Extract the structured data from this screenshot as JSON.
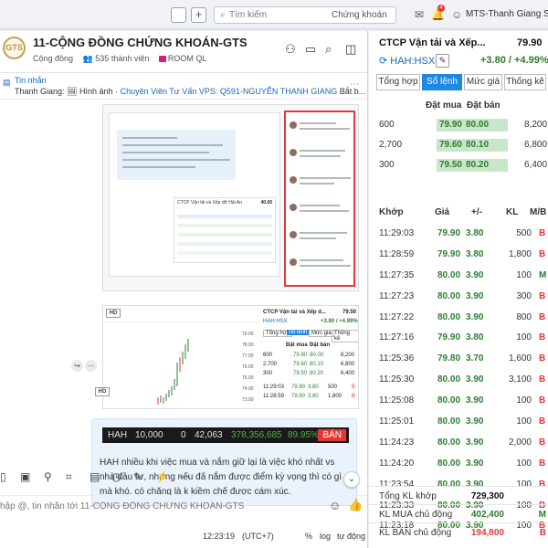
{
  "topbar": {
    "add": "+",
    "search_placeholder": "Tìm kiếm",
    "search_scope": "Chứng khoán",
    "notif_count": "4",
    "username": "MTS-Thanh Giang Stock"
  },
  "chat": {
    "group_name": "11-CỘNG ĐỒNG CHỨNG KHOÁN-GTS",
    "group_type": "Cộng đồng",
    "member_count": "535 thành viên",
    "room_tag": "ROOM QL",
    "pinned": {
      "title": "Tin nhắn",
      "sender": "Thanh Giang:",
      "kind": "Hình ảnh",
      "link_text": "Chuyên Viên Tư Vấn VPS: Q591-NGUYỄN THANH GIANG",
      "suffix": "Bắt b..."
    },
    "hd_label": "HD",
    "shot1": {
      "card_title": "CTCP Vận tải và Xếp dỡ Hải An",
      "card_price": "40.00"
    },
    "shot2": {
      "title": "CTCP Vận tải và Xếp d...",
      "price": "79.50",
      "symbol": "HAH:HSX",
      "change": "+3.80 / +4.99%",
      "tabs": [
        "Tổng hợp",
        "Sổ lệnh",
        "Mức giá",
        "Thống kê"
      ],
      "col_buy": "Đặt mua",
      "col_sell": "Đặt bán",
      "book": [
        {
          "vol": "600",
          "bid": "79.90",
          "ask": "80.00",
          "avol": "8,200"
        },
        {
          "vol": "2,700",
          "bid": "79.60",
          "ask": "80.10",
          "avol": "6,800"
        },
        {
          "vol": "300",
          "bid": "79.50",
          "ask": "80.20",
          "avol": "6,400"
        }
      ],
      "trades": [
        {
          "time": "11:29:03",
          "price": "79.90",
          "chg": "3.80",
          "vol": "500",
          "side": "B"
        },
        {
          "time": "11:28:59",
          "price": "79.90",
          "chg": "3.80",
          "vol": "1,800",
          "side": "B"
        }
      ],
      "axis": [
        "79.00",
        "78.00",
        "77.00",
        "76.00",
        "75.00",
        "74.00",
        "73.00"
      ]
    },
    "shot3": {
      "symbol": "HAH",
      "vol": "10,000",
      "zero": "0",
      "total": "42,063",
      "value": "378,356,685",
      "pct": "89.95%",
      "action": "BÁN"
    },
    "message_text": "HAH nhiều khi việc mua và nắm giữ lại là việc khó nhất vs nhà đầu tư, nhưng nếu đã nắm được điểm kỳ vọng thì có gì mà khó. có chăng là k kiềm chế được cám xúc.",
    "compose_placeholder": "hập @, tin nhắn tới 11-CỘNG ĐỒNG CHỨNG KHOÁN-GTS",
    "status": {
      "time": "12:23:19",
      "tz": "(UTC+7)",
      "percent": "%",
      "log": "log",
      "mode": "tự động"
    }
  },
  "panel": {
    "title": "CTCP Vận tải và Xếp...",
    "price": "79.90",
    "symbol": "HAH:HSX",
    "change": "+3.80 / +4.99%",
    "tabs": [
      "Tổng hợp",
      "Sổ lệnh",
      "Mức giá",
      "Thống kê"
    ],
    "active_tab": 1,
    "col_buy": "Đặt mua",
    "col_sell": "Đặt bán",
    "book": [
      {
        "vol": "600",
        "bid": "79.90",
        "ask": "80.00",
        "avol": "8,200"
      },
      {
        "vol": "2,700",
        "bid": "79.60",
        "ask": "80.10",
        "avol": "6,800"
      },
      {
        "vol": "300",
        "bid": "79.50",
        "ask": "80.20",
        "avol": "6,400"
      }
    ],
    "trade_headers": [
      "Khớp",
      "Giá",
      "+/-",
      "KL",
      "M/B"
    ],
    "trades": [
      {
        "time": "11:29:03",
        "price": "79.90",
        "chg": "3.80",
        "vol": "500",
        "side": "B"
      },
      {
        "time": "11:28:59",
        "price": "79.90",
        "chg": "3.80",
        "vol": "1,800",
        "side": "B"
      },
      {
        "time": "11:27:35",
        "price": "80.00",
        "chg": "3.90",
        "vol": "100",
        "side": "M"
      },
      {
        "time": "11:27:23",
        "price": "80.00",
        "chg": "3.90",
        "vol": "300",
        "side": "B"
      },
      {
        "time": "11:27:22",
        "price": "80.00",
        "chg": "3.90",
        "vol": "800",
        "side": "B"
      },
      {
        "time": "11:27:16",
        "price": "79.90",
        "chg": "3.80",
        "vol": "100",
        "side": "B"
      },
      {
        "time": "11:25:36",
        "price": "79.80",
        "chg": "3.70",
        "vol": "1,600",
        "side": "B"
      },
      {
        "time": "11:25:30",
        "price": "80.00",
        "chg": "3.90",
        "vol": "3,100",
        "side": "B"
      },
      {
        "time": "11:25:08",
        "price": "80.00",
        "chg": "3.90",
        "vol": "100",
        "side": "B"
      },
      {
        "time": "11:25:01",
        "price": "80.00",
        "chg": "3.90",
        "vol": "100",
        "side": "B"
      },
      {
        "time": "11:24:23",
        "price": "80.00",
        "chg": "3.90",
        "vol": "2,000",
        "side": "B"
      },
      {
        "time": "11:24:20",
        "price": "80.00",
        "chg": "3.90",
        "vol": "100",
        "side": "B"
      },
      {
        "time": "11:23:54",
        "price": "80.00",
        "chg": "3.90",
        "vol": "100",
        "side": "B"
      },
      {
        "time": "11:23:33",
        "price": "80.00",
        "chg": "3.90",
        "vol": "100",
        "side": "B"
      },
      {
        "time": "11:23:18",
        "price": "80.00",
        "chg": "3.90",
        "vol": "100",
        "side": "B"
      }
    ],
    "summary": {
      "total_label": "Tổng KL khớp",
      "total_value": "729,300",
      "buy_label": "KL MUA chủ động",
      "buy_value": "402,400",
      "buy_side": "M",
      "sell_label": "KL BÁN chủ động",
      "sell_value": "194,800",
      "sell_side": "B"
    }
  },
  "colors": {
    "up": "#2e7d32",
    "sell": "#e53935",
    "accent": "#1e88e5",
    "bid_bg": "#c8e6c9"
  }
}
